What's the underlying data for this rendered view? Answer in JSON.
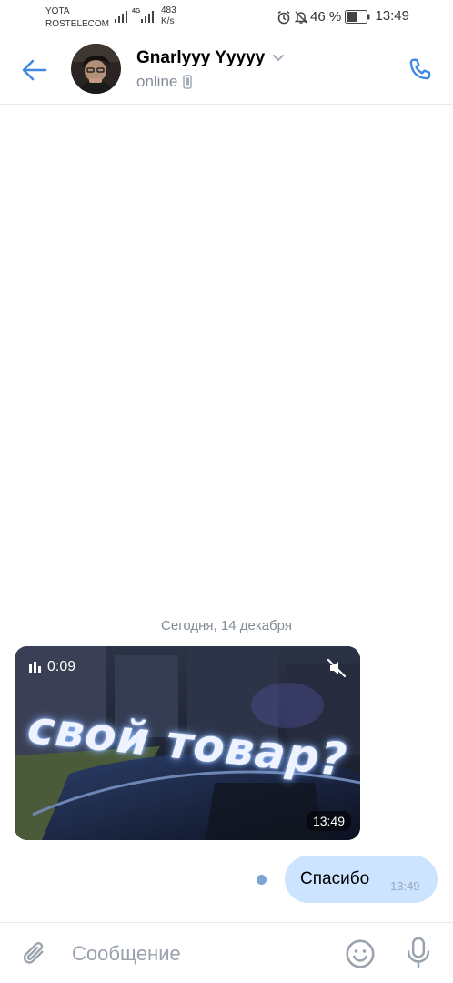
{
  "status_bar": {
    "carrier1": "YOTA",
    "carrier2": "ROSTELECOM",
    "net_type": "4G",
    "net_speed_value": "483",
    "net_speed_unit": "K/s",
    "battery_percent": "46 %",
    "time": "13:49",
    "icons": [
      "alarm-icon",
      "bell-muted-icon",
      "battery-icon"
    ]
  },
  "header": {
    "contact_name": "Gnarlyyy Yyyyy",
    "status": "online",
    "icons": [
      "back-arrow-icon",
      "chevron-down-icon",
      "mobile-device-icon",
      "phone-icon"
    ],
    "accent_color": "#3f8ae0"
  },
  "chat": {
    "date_separator": "Сегодня, 14 декабря",
    "incoming_video": {
      "duration": "0:09",
      "title_overlay": "свой товар?",
      "time": "13:49"
    },
    "outgoing_message": {
      "text": "Спасибо",
      "time": "13:49",
      "bubble_color": "#cce4ff"
    }
  },
  "composer": {
    "placeholder": "Сообщение",
    "icons": [
      "paperclip-icon",
      "emoji-icon",
      "microphone-icon"
    ]
  }
}
